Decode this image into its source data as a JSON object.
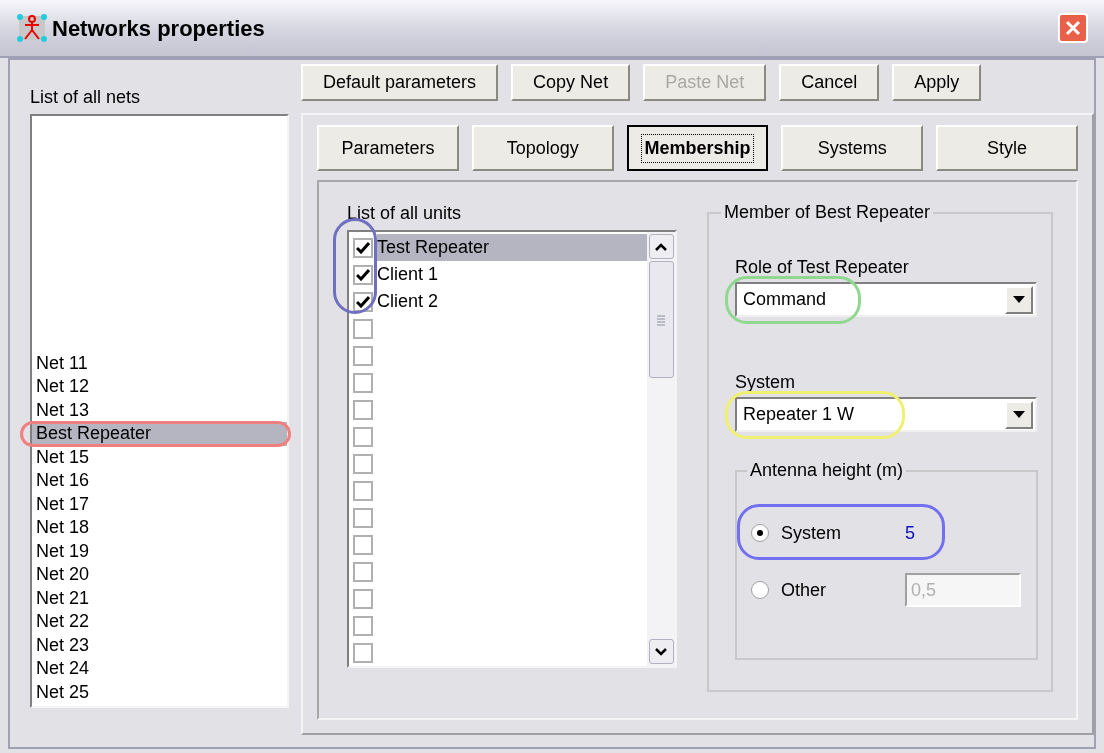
{
  "window": {
    "title": "Networks properties"
  },
  "nets_label": "List of all nets",
  "nets": [
    {
      "label": "Net 11",
      "selected": false
    },
    {
      "label": "Net 12",
      "selected": false
    },
    {
      "label": "Net 13",
      "selected": false
    },
    {
      "label": "Best Repeater",
      "selected": true,
      "color": "#f08080"
    },
    {
      "label": "Net 15",
      "selected": false
    },
    {
      "label": "Net 16",
      "selected": false
    },
    {
      "label": "Net 17",
      "selected": false
    },
    {
      "label": "Net 18",
      "selected": false
    },
    {
      "label": "Net 19",
      "selected": false
    },
    {
      "label": "Net 20",
      "selected": false
    },
    {
      "label": "Net 21",
      "selected": false
    },
    {
      "label": "Net 22",
      "selected": false
    },
    {
      "label": "Net 23",
      "selected": false
    },
    {
      "label": "Net 24",
      "selected": false
    },
    {
      "label": "Net 25",
      "selected": false
    }
  ],
  "buttons": [
    {
      "label": "Default parameters",
      "disabled": false
    },
    {
      "label": "Copy Net",
      "disabled": false
    },
    {
      "label": "Paste Net",
      "disabled": true
    },
    {
      "label": "Cancel",
      "disabled": false
    },
    {
      "label": "Apply",
      "disabled": false
    }
  ],
  "tabs": [
    {
      "label": "Parameters",
      "selected": false
    },
    {
      "label": "Topology",
      "selected": false
    },
    {
      "label": "Membership",
      "selected": true
    },
    {
      "label": "Systems",
      "selected": false
    },
    {
      "label": "Style",
      "selected": false
    }
  ],
  "units": {
    "label": "List of all units",
    "color": "#7070c0",
    "rows": [
      {
        "label": "Test Repeater",
        "checked": true,
        "selected": true
      },
      {
        "label": "Client 1",
        "checked": true,
        "selected": false
      },
      {
        "label": "Client 2",
        "checked": true,
        "selected": false
      },
      {
        "checked": false,
        "selected": false
      },
      {
        "checked": false,
        "selected": false
      },
      {
        "checked": false,
        "selected": false
      },
      {
        "checked": false,
        "selected": false
      },
      {
        "checked": false,
        "selected": false
      },
      {
        "checked": false,
        "selected": false
      },
      {
        "checked": false,
        "selected": false
      },
      {
        "checked": false,
        "selected": false
      },
      {
        "checked": false,
        "selected": false
      },
      {
        "checked": false,
        "selected": false
      },
      {
        "checked": false,
        "selected": false
      },
      {
        "checked": false,
        "selected": false
      },
      {
        "checked": false,
        "selected": false
      }
    ]
  },
  "member": {
    "title": "Member of Best Repeater",
    "role": {
      "label": "Role of Test Repeater",
      "value": "Command",
      "color": "#90d890"
    },
    "system": {
      "label": "System",
      "value": "Repeater 1 W",
      "color": "#f0f070"
    },
    "antenna": {
      "title": "Antenna height (m)",
      "options": [
        {
          "label": "System",
          "selected": true,
          "value": "5",
          "color": "#7070f0"
        },
        {
          "label": "Other",
          "selected": false,
          "field": "0,5",
          "field_disabled": true
        }
      ]
    }
  }
}
